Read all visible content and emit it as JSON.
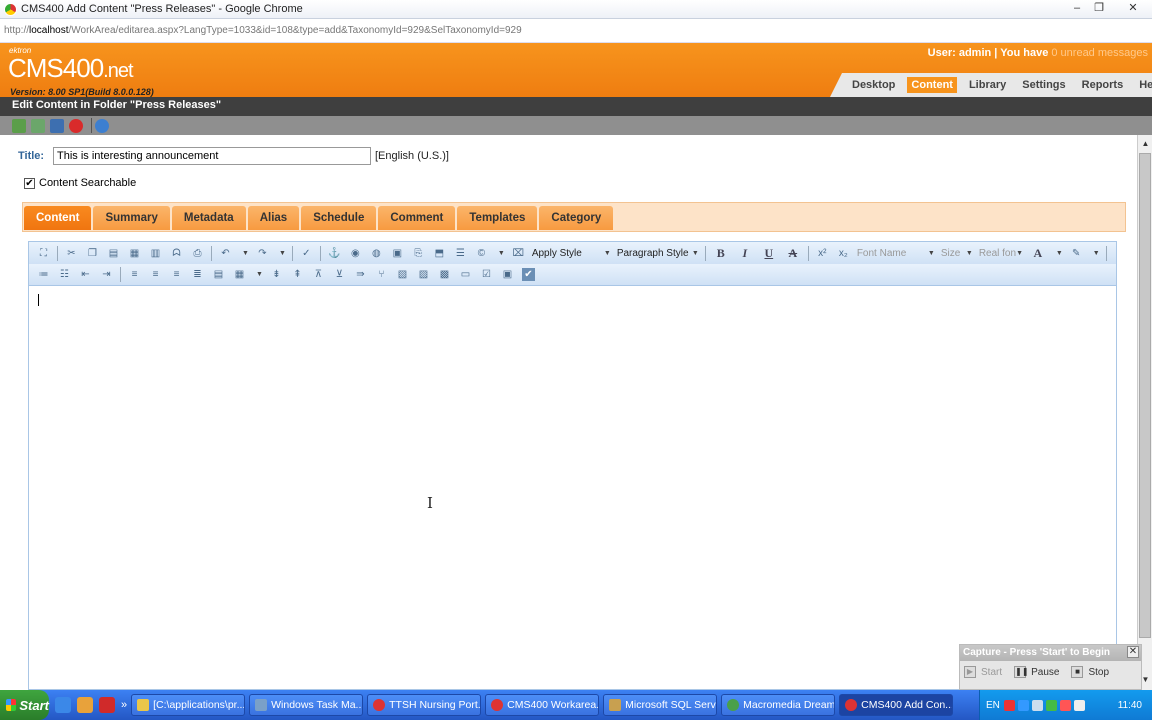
{
  "window": {
    "title": "CMS400 Add Content \"Press Releases\" - Google Chrome",
    "url_prefix": "http://",
    "url_host": "localhost",
    "url_path": "/WorkArea/editarea.aspx?LangType=1033&id=108&type=add&TaxonomyId=929&SelTaxonomyId=929"
  },
  "brand": {
    "ektron": "ektron",
    "cms": "CMS",
    "num": "400",
    "net": ".net",
    "version": "Version: 8.00 SP1(Build 8.0.0.128)"
  },
  "user": {
    "text": "User: admin | You have ",
    "unread": "0 unread messages"
  },
  "nav": [
    "Desktop",
    "Content",
    "Library",
    "Settings",
    "Reports",
    "Help"
  ],
  "folder_title": "Edit Content in Folder \"Press Releases\"",
  "form": {
    "title_label": "Title:",
    "title_value": "This is interesting announcement",
    "language": "[English (U.S.)]",
    "searchable_label": "Content Searchable",
    "searchable_checked": "✔"
  },
  "tabs": [
    "Content",
    "Summary",
    "Metadata",
    "Alias",
    "Schedule",
    "Comment",
    "Templates",
    "Category"
  ],
  "editor": {
    "apply_style": "Apply Style",
    "paragraph_style": "Paragraph Style",
    "font_name": "Font Name",
    "size": "Size",
    "real_font": "Real fon"
  },
  "capture": {
    "title": "Capture - Press 'Start' to Begin",
    "start": "Start",
    "pause": "Pause",
    "stop": "Stop"
  },
  "taskbar": {
    "start": "Start",
    "items": [
      "[C:\\applications\\pr...",
      "Windows Task Ma...",
      "TTSH Nursing Port...",
      "CMS400 Workarea...",
      "Microsoft SQL Serv...",
      "Macromedia Dream...",
      "CMS400 Add Con..."
    ],
    "lang": "EN",
    "clock": "11:40"
  }
}
